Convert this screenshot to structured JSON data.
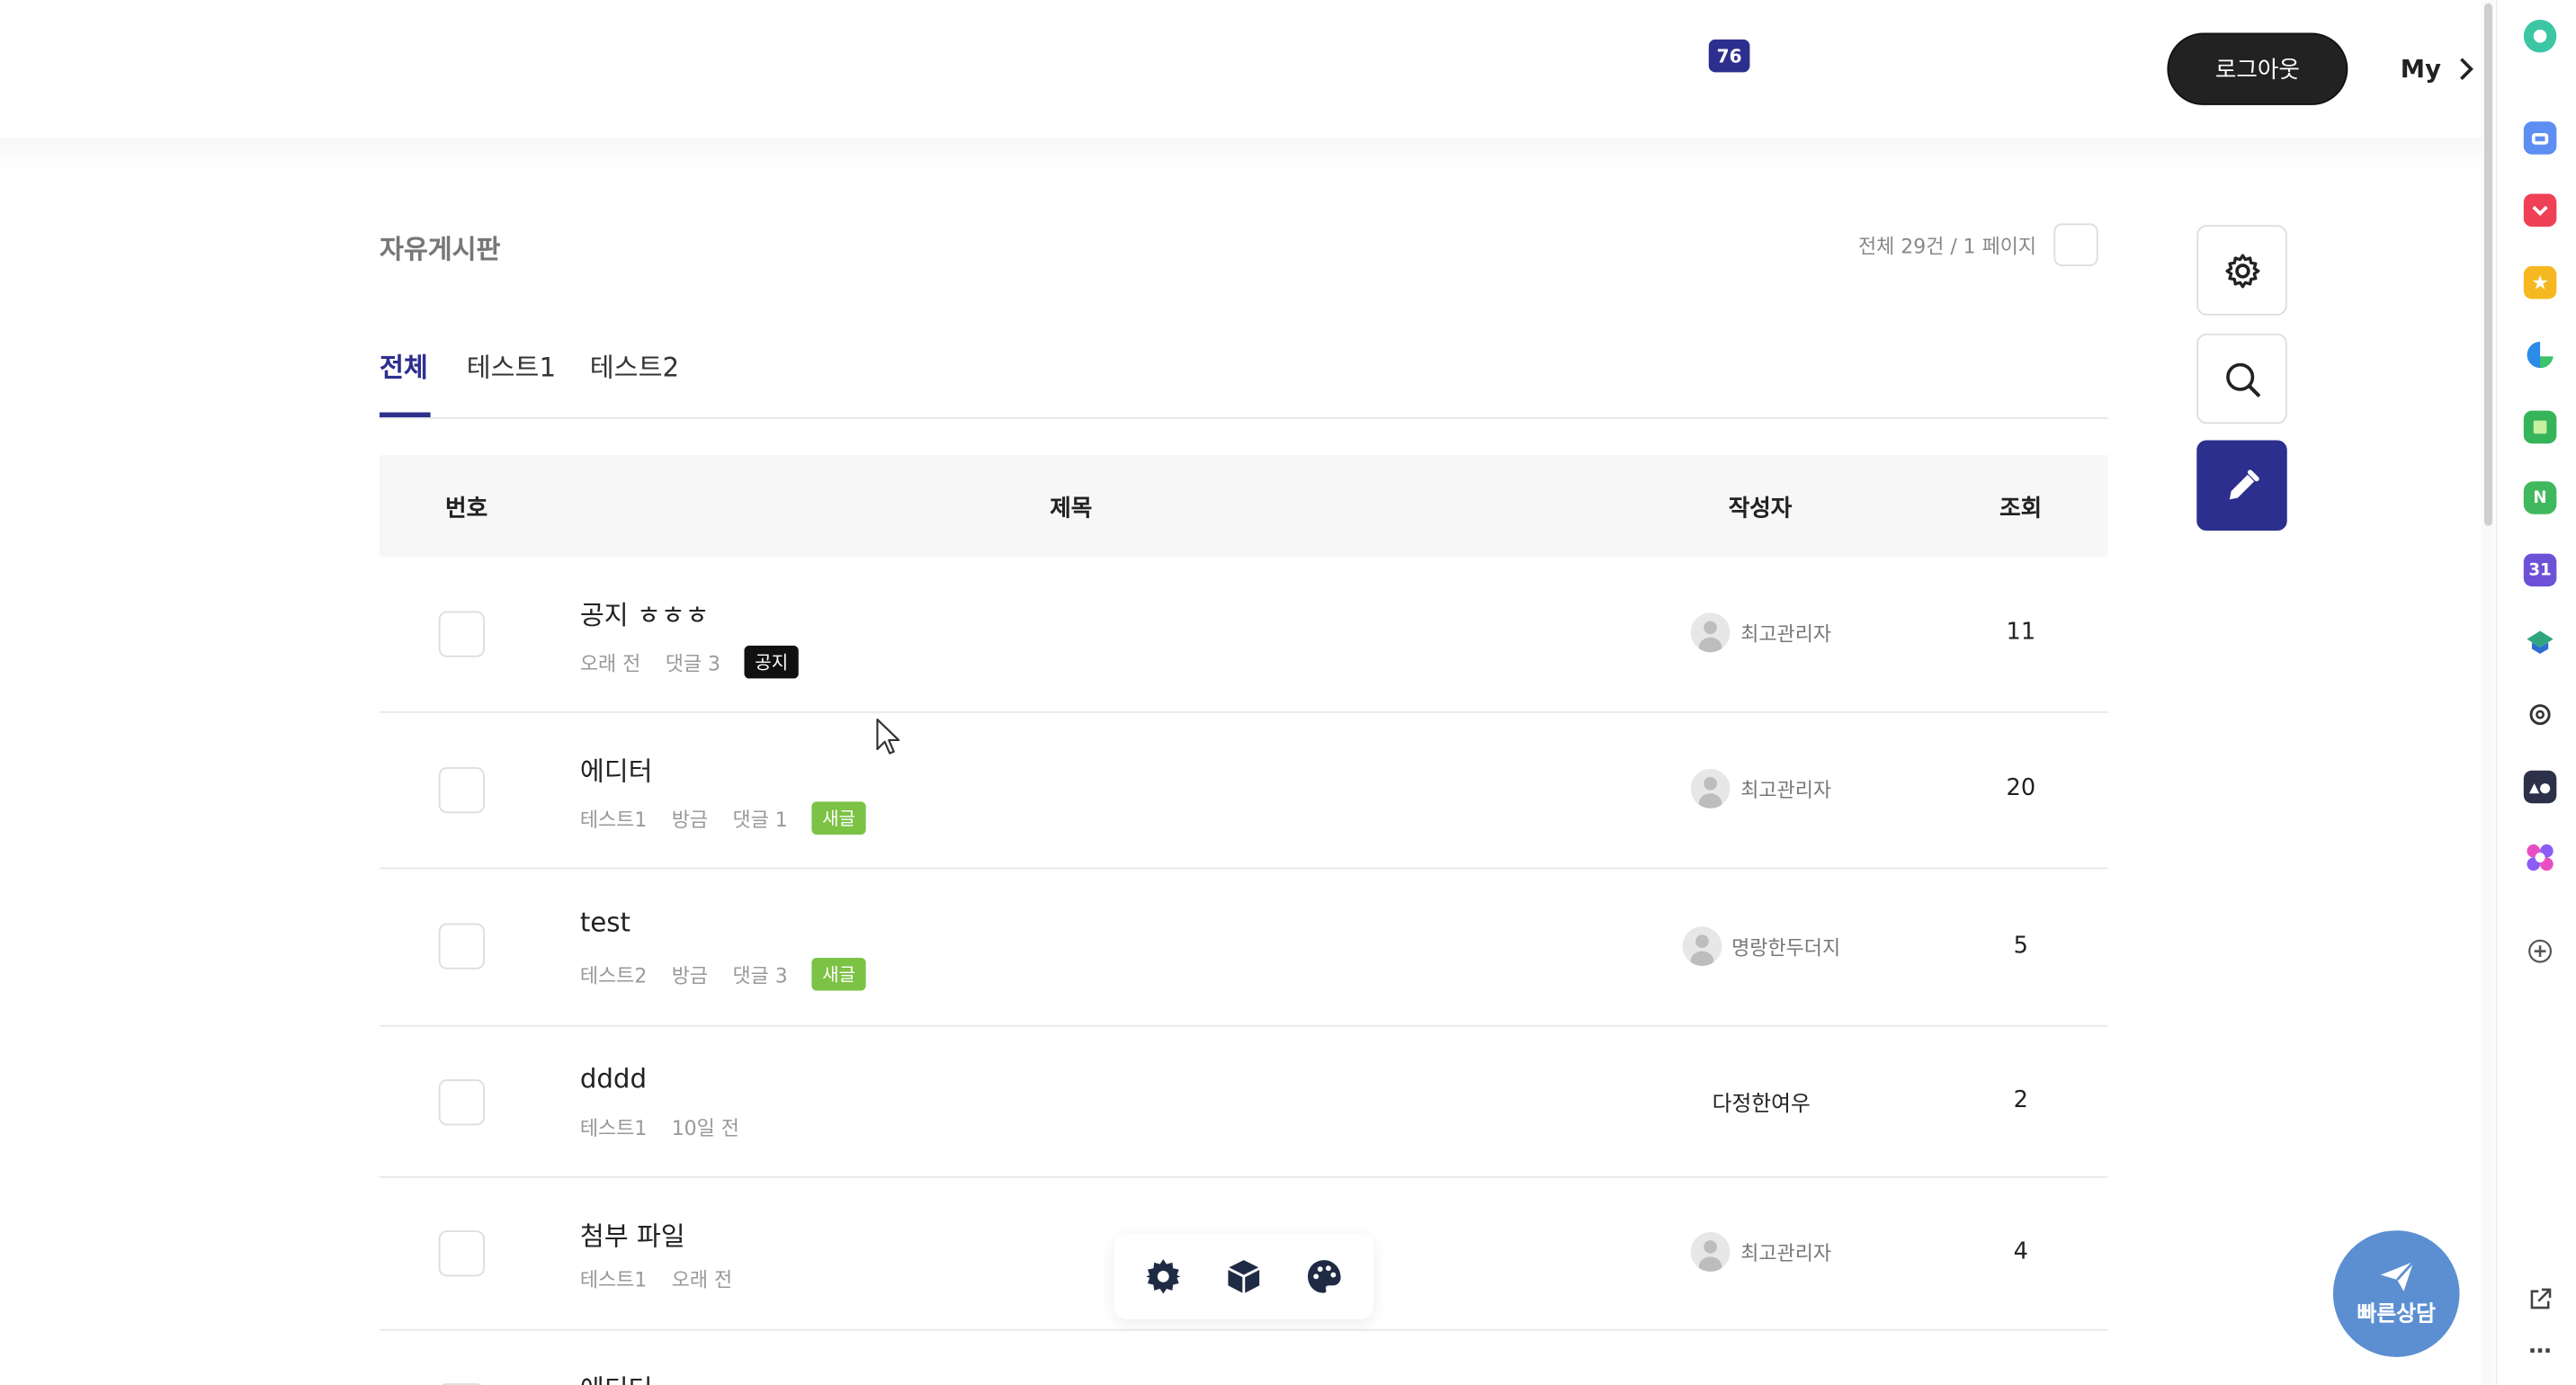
{
  "header": {
    "notification_count": "76",
    "logout_label": "로그아웃",
    "my_label": "My"
  },
  "board": {
    "title": "자유게시판",
    "count_text": "전체 29건 / 1 페이지"
  },
  "tabs": [
    {
      "label": "전체",
      "active": true
    },
    {
      "label": "테스트1",
      "active": false
    },
    {
      "label": "테스트2",
      "active": false
    }
  ],
  "table": {
    "headers": {
      "number": "번호",
      "title": "제목",
      "author": "작성자",
      "views": "조회"
    },
    "rows": [
      {
        "title": "공지 ㅎㅎㅎ",
        "meta": [
          "오래 전",
          "댓글 3"
        ],
        "tag": "공지",
        "author": "최고관리자",
        "views": "11"
      },
      {
        "title": "에디터",
        "meta": [
          "테스트1",
          "방금",
          "댓글 1"
        ],
        "tag": "새글",
        "author": "최고관리자",
        "views": "20"
      },
      {
        "title": "test",
        "meta": [
          "테스트2",
          "방금",
          "댓글 3"
        ],
        "tag": "새글",
        "author": "명랑한두더지",
        "views": "5"
      },
      {
        "title": "dddd",
        "meta": [
          "테스트1",
          "10일 전"
        ],
        "tag": "",
        "author": "다정한여우",
        "views": "2"
      },
      {
        "title": "첨부 파일",
        "meta": [
          "테스트1",
          "오래 전"
        ],
        "tag": "",
        "author": "최고관리자",
        "views": "4"
      },
      {
        "title": "에디터",
        "meta": [],
        "tag": "",
        "author": "",
        "views": ""
      }
    ]
  },
  "actions": {
    "settings_icon": "gear-icon",
    "search_icon": "search-icon",
    "write_icon": "pencil-icon"
  },
  "float_toolbar": [
    "gear-icon",
    "cube-icon",
    "palette-icon"
  ],
  "quick_consult_label": "빠른상담",
  "extensions": {
    "calendar_day": "31"
  },
  "colors": {
    "primary": "#2d2f8e",
    "new_tag": "#7cc245",
    "quick_consult": "#5b8fd1"
  }
}
